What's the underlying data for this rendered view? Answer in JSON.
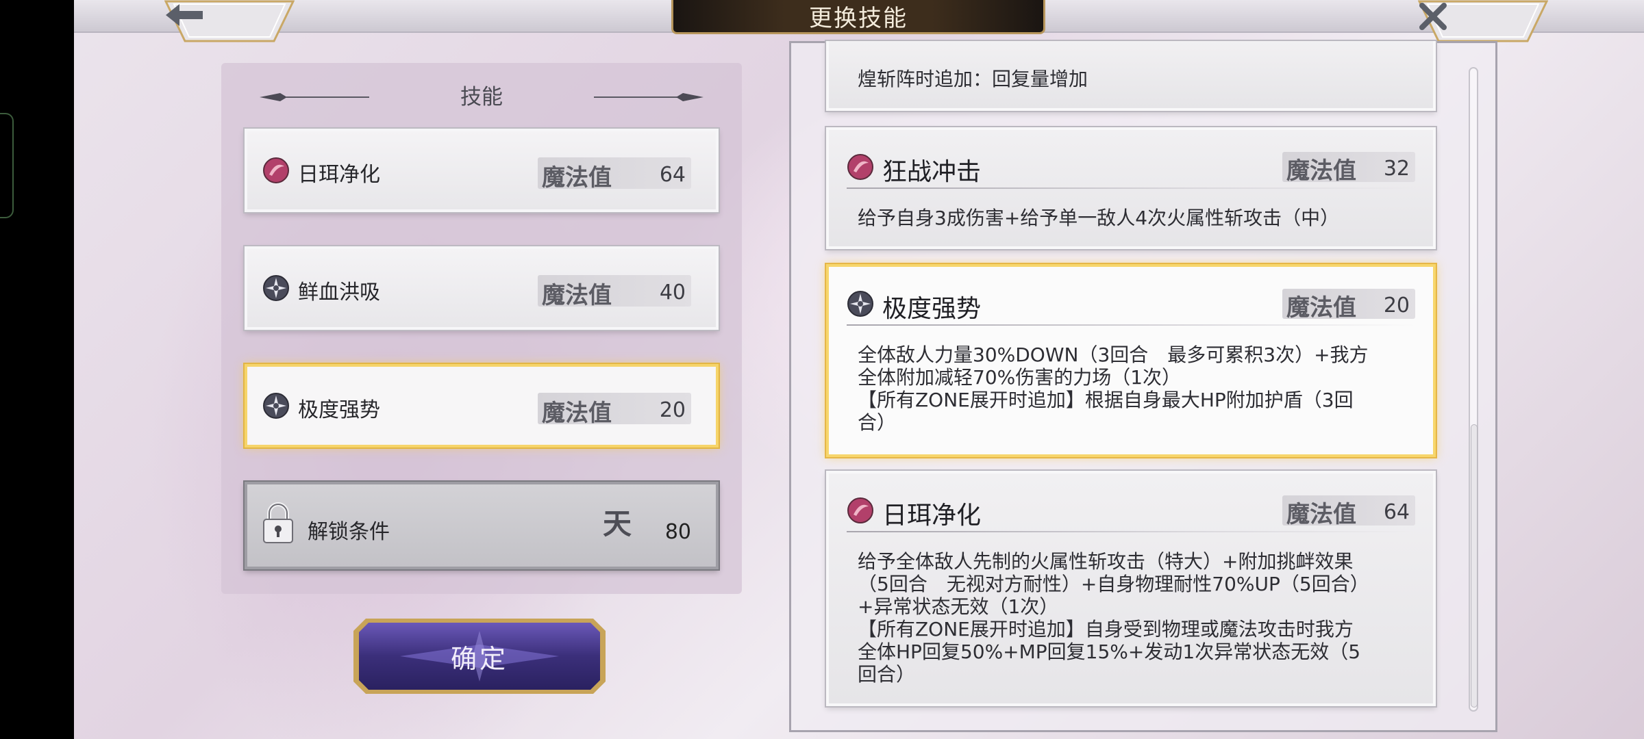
{
  "header": {
    "title": "更换技能",
    "back_icon": "arrow-left-icon",
    "close_icon": "close-icon"
  },
  "left_panel": {
    "heading": "技能",
    "skills": [
      {
        "name": "日珥净化",
        "mp_label": "魔法值",
        "mp": "64",
        "icon": "fire-orb-icon",
        "selected": false
      },
      {
        "name": "鲜血洪吸",
        "mp_label": "魔法值",
        "mp": "40",
        "icon": "neutral-star-icon",
        "selected": false
      },
      {
        "name": "极度强势",
        "mp_label": "魔法值",
        "mp": "20",
        "icon": "neutral-star-icon",
        "selected": true
      }
    ],
    "locked_slot": {
      "label": "解锁条件",
      "rank_glyph": "天",
      "value": "80"
    },
    "confirm_label": "确定"
  },
  "right_panel": {
    "partial_card_text": "煌斩阵时追加：回复量增加",
    "details": [
      {
        "name": "狂战冲击",
        "mp_label": "魔法值",
        "mp": "32",
        "icon": "fire-orb-icon",
        "description": "给予自身3成伤害+给予单一敌人4次火属性斩攻击（中）",
        "selected": false
      },
      {
        "name": "极度强势",
        "mp_label": "魔法值",
        "mp": "20",
        "icon": "neutral-star-icon",
        "description": "全体敌人力量30%DOWN（3回合　最多可累积3次）+我方\n全体附加减轻70%伤害的力场（1次）\n【所有ZONE展开时追加】根据自身最大HP附加护盾（3回\n合）",
        "selected": true
      },
      {
        "name": "日珥净化",
        "mp_label": "魔法值",
        "mp": "64",
        "icon": "fire-orb-icon",
        "description": "给予全体敌人先制的火属性斩攻击（特大）+附加挑衅效果\n（5回合　无视对方耐性）+自身物理耐性70%UP（5回合）\n+异常状态无效（1次）\n【所有ZONE展开时追加】自身受到物理或魔法攻击时我方\n全体HP回复50%+MP回复15%+发动1次异常状态无效（5\n回合）",
        "selected": false
      }
    ]
  },
  "colors": {
    "highlight_gold": "#f6d46a",
    "fire_orb": "#b2406a",
    "confirm_purple": "#4b3d8c"
  }
}
